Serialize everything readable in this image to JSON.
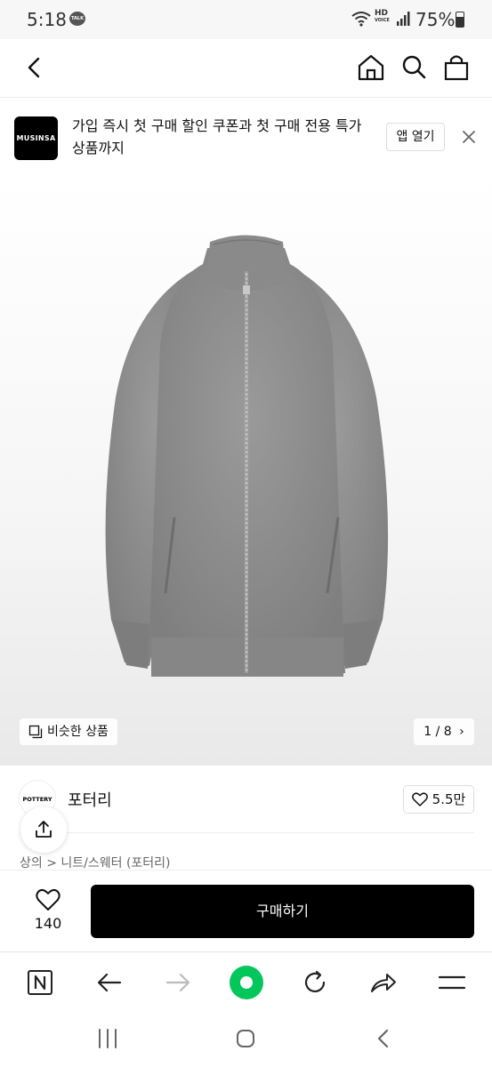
{
  "status_bar": {
    "time": "5:18",
    "talk_label": "TALK",
    "hd_label": "HD",
    "voice_label": "VOICE",
    "battery": "75%"
  },
  "header": {
    "icons": [
      "back-icon",
      "home-icon",
      "search-icon",
      "bag-icon"
    ]
  },
  "promo": {
    "logo_text": "MUSINSA",
    "text": "가입 즉시 첫 구매 할인 쿠폰과 첫 구매 전용 특가 상품까지",
    "open_button": "앱 열기"
  },
  "gallery": {
    "similar_label": "비슷한 상품",
    "pager": "1 / 8"
  },
  "brand": {
    "logo_text": "POTTERY",
    "name": "포터리",
    "likes": "5.5만"
  },
  "breadcrumb": "상의 > 니트/스웨터 (포터리)",
  "buy_bar": {
    "wish_count": "140",
    "buy_label": "구매하기"
  },
  "colors": {
    "accent_green": "#03c75a",
    "black": "#000000",
    "sweater_gray": "#8d8d8d"
  },
  "browser_toolbar": {
    "icons": [
      "naver-icon",
      "back-arrow-icon",
      "forward-arrow-icon",
      "green-dot-icon",
      "refresh-icon",
      "share-icon",
      "menu-icon"
    ]
  },
  "android_nav": {
    "icons": [
      "recents-icon",
      "home-circle-icon",
      "back-chevron-icon"
    ]
  }
}
